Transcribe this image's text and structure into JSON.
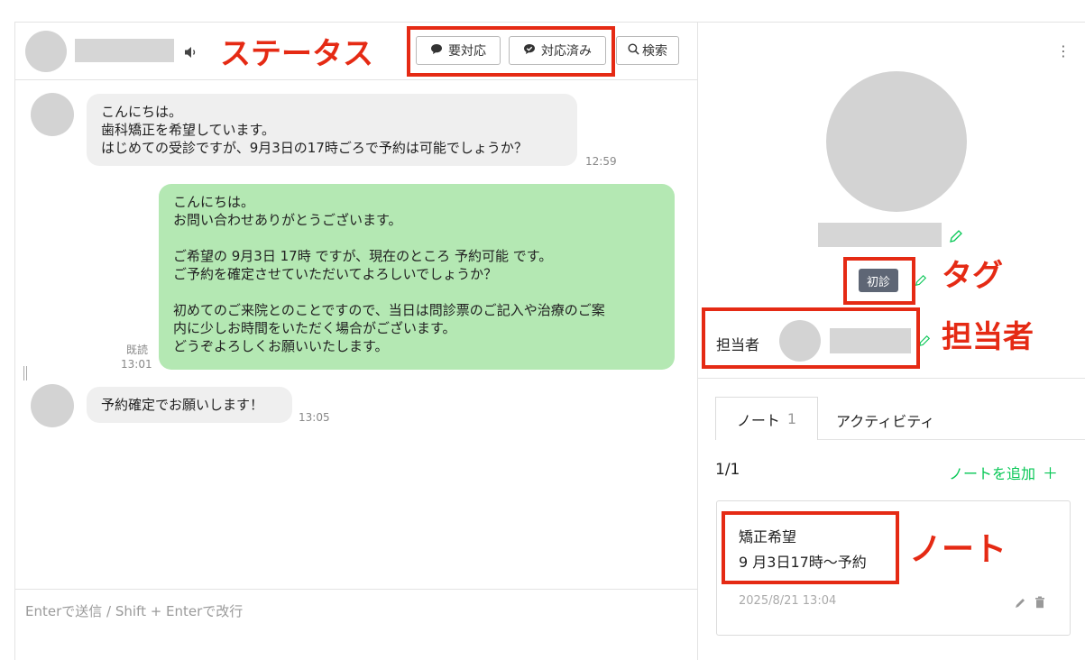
{
  "header": {
    "speaker_icon": "speaker-icon",
    "buttons": {
      "needs_action": "要対応",
      "done": "対応済み",
      "search": "検索"
    }
  },
  "messages": [
    {
      "side": "in",
      "lines": [
        "こんにちは。",
        "歯科矯正を希望しています。",
        "はじめての受診ですが、9月3日の17時ごろで予約は可能でしょうか？"
      ],
      "time": "12:59"
    },
    {
      "side": "out",
      "lines": [
        "こんにちは。",
        "お問い合わせありがとうございます。",
        "",
        "ご希望の 9月3日 17時 ですが、現在のところ 予約可能 です。",
        "ご予約を確定させていただいてよろしいでしょうか？",
        "",
        "初めてのご来院とのことですので、当日は問診票のご記入や治療のご案",
        "内に少しお時間をいただく場合がございます。",
        "どうぞよろしくお願いいたします。"
      ],
      "read": "既読",
      "time": "13:01"
    },
    {
      "side": "in",
      "lines": [
        "予約確定でお願いします！"
      ],
      "time": "13:05"
    }
  ],
  "composer": {
    "placeholder": "Enterで送信 / Shift + Enterで改行"
  },
  "profile": {
    "menu_icon": "⋮",
    "tag": "初診",
    "assignee_label": "担当者"
  },
  "notes": {
    "tabs": [
      {
        "label": "ノート",
        "count": "1"
      },
      {
        "label": "アクティビティ"
      }
    ],
    "page": "1/1",
    "add_label": "ノートを追加",
    "add_icon": "＋",
    "items": [
      {
        "lines": [
          "矯正希望",
          "9 月3日17時〜予約"
        ],
        "timestamp": "2025/8/21 13:04"
      }
    ]
  },
  "annotations": {
    "status": "ステータス",
    "tag": "タグ",
    "assignee": "担当者",
    "note": "ノート"
  },
  "colors": {
    "annotation_red": "#e52a14",
    "outgoing_bubble": "#b4e8b3",
    "incoming_bubble": "#efefef",
    "accent_green": "#06c755",
    "tag_bg": "#5e6675"
  }
}
